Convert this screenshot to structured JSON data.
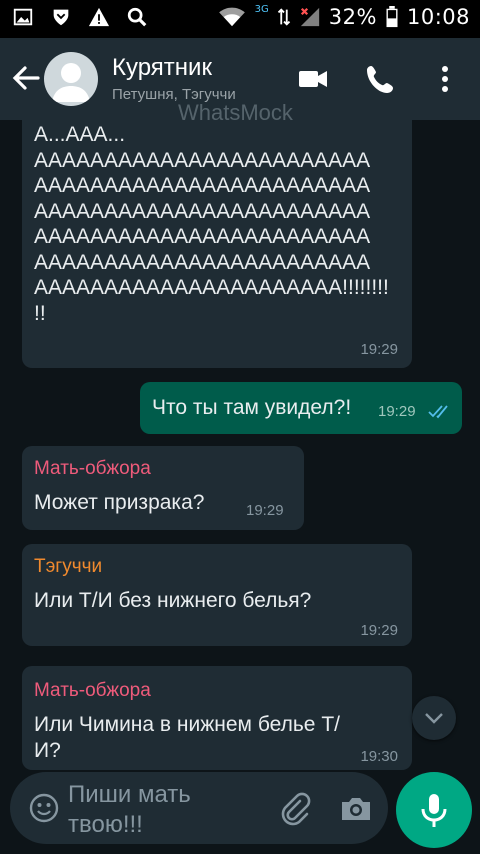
{
  "status_bar": {
    "network_badge": "3G",
    "battery": "32%",
    "time": "10:08",
    "icons": [
      "image-icon",
      "shield-icon",
      "warning-icon",
      "search-icon",
      "wifi-icon",
      "signal-icon",
      "battery-icon"
    ]
  },
  "header": {
    "title": "Курятник",
    "subtitle": "Петушня, Тэгуччи",
    "watermark": "WhatsMock",
    "icons": [
      "back-arrow-icon",
      "avatar-icon",
      "video-call-icon",
      "phone-icon",
      "more-vert-icon"
    ]
  },
  "messages": [
    {
      "direction": "in",
      "lines": [
        "А...ААА...",
        "АААААААААААААААААААААААА",
        "АААААААААААААААААААААААА",
        "АААААААААААААААААААААААА",
        "АААААААААААААААААААААААА",
        "АААААААААААААААААААААААА",
        "АААААААААААААААААААААА!!!!!!!!",
        "!!"
      ],
      "time": "19:29"
    },
    {
      "direction": "out",
      "text": "Что ты там увидел?!",
      "time": "19:29",
      "status": "read"
    },
    {
      "direction": "in",
      "sender": "Мать-обжора",
      "sender_color": "#ef5b7b",
      "text": "Может призрака?",
      "time": "19:29"
    },
    {
      "direction": "in",
      "sender": "Тэгуччи",
      "sender_color": "#f08a2e",
      "text": "Или Т/И без нижнего белья?",
      "time": "19:29"
    },
    {
      "direction": "in",
      "sender": "Мать-обжора",
      "sender_color": "#ef5b7b",
      "lines": [
        "Или Чимина в нижнем белье Т/",
        "И?"
      ],
      "time": "19:30"
    }
  ],
  "input": {
    "placeholder_lines": [
      "Пиши мать",
      "твою!!!"
    ]
  },
  "colors": {
    "background": "#0d1418",
    "bubble_in": "#1f2c34",
    "bubble_out": "#005c4b",
    "accent": "#00a884",
    "read_ticks": "#53bdeb"
  }
}
